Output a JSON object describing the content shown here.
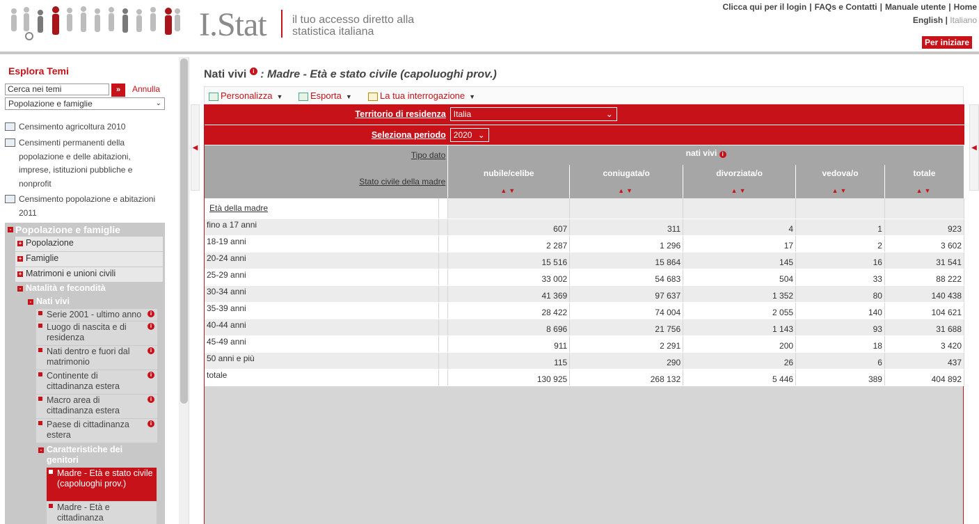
{
  "header": {
    "logo": "I.Stat",
    "tagline": "il tuo accesso diretto alla statistica italiana",
    "links": [
      "Clicca qui per il login",
      "FAQs e Contatti",
      "Manuale utente",
      "Home"
    ],
    "lang_en": "English",
    "lang_it": "Italiano",
    "per_iniziare": "Per iniziare"
  },
  "sidebar": {
    "title": "Esplora Temi",
    "search_placeholder": "Cerca nei temi",
    "search_go": "»",
    "annulla": "Annulla",
    "theme_select": "Popolazione e famiglie",
    "census": [
      "Censimento agricoltura 2010",
      "Censimenti permanenti della popolazione e delle abitazioni, imprese, istituzioni pubbliche e nonprofit",
      "Censimento popolazione e abitazioni 2011"
    ],
    "tree": {
      "root": "Popolazione e famiglie",
      "l1": [
        "Popolazione",
        "Famiglie",
        "Matrimoni e unioni civili",
        "Natalità e fecondità"
      ],
      "l2": "Nati vivi",
      "leaves": [
        "Serie 2001 - ultimo anno",
        "Luogo di nascita e di residenza",
        "Nati dentro e fuori dal matrimonio",
        "Continente di cittadinanza estera",
        "Macro area di cittadinanza estera",
        "Paese di cittadinanza estera"
      ],
      "l3": "Caratteristiche dei genitori",
      "sub": [
        "Madre - Età e stato civile (capoluoghi prov.)",
        "Madre - Età e cittadinanza"
      ]
    }
  },
  "main": {
    "title": "Nati vivi",
    "subtitle": ": Madre - Età e stato civile (capoluoghi prov.)",
    "toolbar": {
      "personalizza": "Personalizza",
      "esporta": "Esporta",
      "interrogazione": "La tua interrogazione"
    },
    "filters": {
      "territorio_label": "Territorio di residenza",
      "territorio_value": "Italia",
      "periodo_label": "Seleziona periodo",
      "periodo_value": "2020"
    },
    "tipo_dato_label": "Tipo dato",
    "tipo_dato_value": "nati vivi",
    "stato_label": "Stato civile della madre",
    "eta_label": "Età della madre",
    "columns": [
      "nubile/celibe",
      "coniugata/o",
      "divorziata/o",
      "vedova/o",
      "totale"
    ],
    "rows": [
      {
        "label": "fino a 17 anni",
        "v": [
          "607",
          "311",
          "4",
          "1",
          "923"
        ]
      },
      {
        "label": "18-19 anni",
        "v": [
          "2 287",
          "1 296",
          "17",
          "2",
          "3 602"
        ]
      },
      {
        "label": "20-24 anni",
        "v": [
          "15 516",
          "15 864",
          "145",
          "16",
          "31 541"
        ]
      },
      {
        "label": "25-29 anni",
        "v": [
          "33 002",
          "54 683",
          "504",
          "33",
          "88 222"
        ]
      },
      {
        "label": "30-34 anni",
        "v": [
          "41 369",
          "97 637",
          "1 352",
          "80",
          "140 438"
        ]
      },
      {
        "label": "35-39 anni",
        "v": [
          "28 422",
          "74 004",
          "2 055",
          "140",
          "104 621"
        ]
      },
      {
        "label": "40-44 anni",
        "v": [
          "8 696",
          "21 756",
          "1 143",
          "93",
          "31 688"
        ]
      },
      {
        "label": "45-49 anni",
        "v": [
          "911",
          "2 291",
          "200",
          "18",
          "3 420"
        ]
      },
      {
        "label": "50 anni e più",
        "v": [
          "115",
          "290",
          "26",
          "6",
          "437"
        ]
      },
      {
        "label": "totale",
        "v": [
          "130 925",
          "268 132",
          "5 446",
          "389",
          "404 892"
        ]
      }
    ]
  }
}
